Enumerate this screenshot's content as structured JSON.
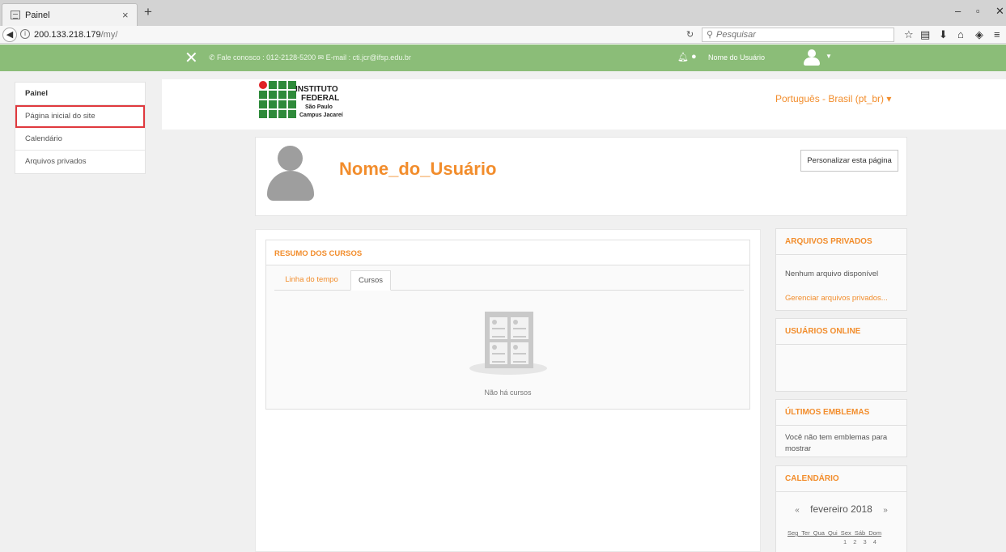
{
  "browser": {
    "tab_title": "Painel",
    "tab_close": "×",
    "new_tab": "+",
    "url_host": "200.133.218.179",
    "url_path": "/my/",
    "search_placeholder": "Pesquisar"
  },
  "topbar": {
    "close_glyph": "✕",
    "contact": "✆ Fale conosco : 012-2128-5200  ✉ E-mail : cti.jcr@ifsp.edu.br",
    "user_name": "Nome do Usuário"
  },
  "logo": {
    "line1": "INSTITUTO",
    "line2": "FEDERAL",
    "line3": "São Paulo",
    "line4": "Campus Jacareí"
  },
  "language": "Português - Brasil (pt_br) ▾",
  "sidebar": {
    "items": [
      {
        "label": "Painel"
      },
      {
        "label": "Página inicial do site"
      },
      {
        "label": "Calendário"
      },
      {
        "label": "Arquivos privados"
      }
    ]
  },
  "profile": {
    "name": "Nome_do_Usuário",
    "customize_button": "Personalizar esta página"
  },
  "course_overview": {
    "title": "RESUMO DOS CURSOS",
    "tabs": [
      "Linha do tempo",
      "Cursos"
    ],
    "empty_text": "Não há cursos"
  },
  "blocks": {
    "private_files": {
      "title": "ARQUIVOS PRIVADOS",
      "text": "Nenhum arquivo disponível",
      "link": "Gerenciar arquivos privados..."
    },
    "online_users": {
      "title": "USUÁRIOS ONLINE"
    },
    "badges": {
      "title": "ÚLTIMOS EMBLEMAS",
      "text": "Você não tem emblemas para mostrar"
    },
    "calendar": {
      "title": "CALENDÁRIO",
      "prev": "«",
      "month": "fevereiro 2018",
      "next": "»",
      "weekdays": "Seg Ter Qua Qui Sex Sáb Dom",
      "first_days": "1 2 3 4"
    }
  }
}
